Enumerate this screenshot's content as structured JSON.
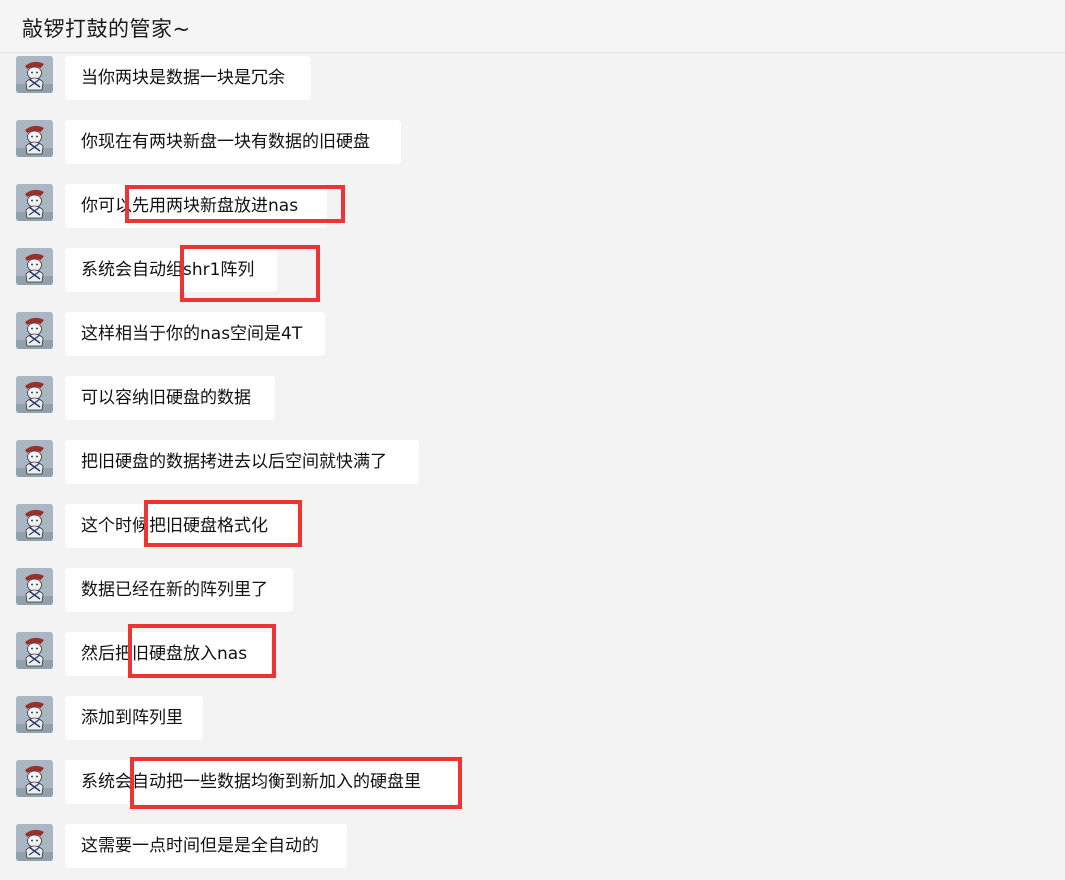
{
  "header": {
    "title": "敲锣打鼓的管家~"
  },
  "messages": [
    {
      "text": "当你两块是数据一块是冗余",
      "avatar": "user-avatar"
    },
    {
      "text": "你现在有两块新盘一块有数据的旧硬盘",
      "avatar": "user-avatar"
    },
    {
      "text": "你可以先用两块新盘放进nas",
      "avatar": "user-avatar"
    },
    {
      "text": "系统会自动组shr1阵列",
      "avatar": "user-avatar"
    },
    {
      "text": "这样相当于你的nas空间是4T",
      "avatar": "user-avatar"
    },
    {
      "text": "可以容纳旧硬盘的数据",
      "avatar": "user-avatar"
    },
    {
      "text": "把旧硬盘的数据拷进去以后空间就快满了",
      "avatar": "user-avatar"
    },
    {
      "text": "这个时候把旧硬盘格式化",
      "avatar": "user-avatar"
    },
    {
      "text": "数据已经在新的阵列里了",
      "avatar": "user-avatar"
    },
    {
      "text": "然后把旧硬盘放入nas",
      "avatar": "user-avatar"
    },
    {
      "text": "添加到阵列里",
      "avatar": "user-avatar"
    },
    {
      "text": "系统会自动把一些数据均衡到新加入的硬盘里",
      "avatar": "user-avatar"
    },
    {
      "text": "这需要一点时间但是是全自动的",
      "avatar": "user-avatar"
    }
  ],
  "colors": {
    "highlight": "#ee3333",
    "bubble": "#ffffff",
    "background": "#f3f3f3"
  }
}
